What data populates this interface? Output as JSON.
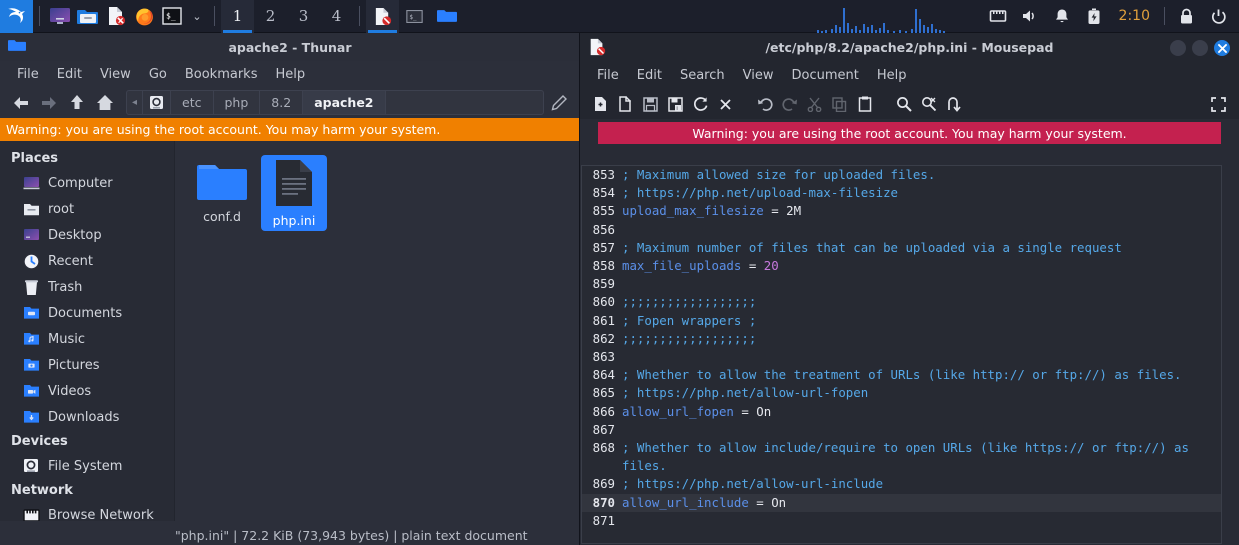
{
  "taskbar": {
    "kali_logo": "kali-dragon-logo",
    "launchers": [
      {
        "name": "show-desktop-icon",
        "label": "Show Desktop"
      },
      {
        "name": "file-manager-icon",
        "label": "File Manager"
      },
      {
        "name": "text-editor-icon",
        "label": "Text Editor"
      },
      {
        "name": "firefox-icon",
        "label": "Firefox"
      },
      {
        "name": "terminal-icon",
        "label": "Terminal"
      }
    ],
    "launcher_chevron": "⌄",
    "workspaces": [
      {
        "label": "1",
        "active": true
      },
      {
        "label": "2",
        "active": false
      },
      {
        "label": "3",
        "active": false
      },
      {
        "label": "4",
        "active": false
      }
    ],
    "windows": [
      {
        "name": "taskbar-window-mousepad",
        "icon": "text-editor-icon",
        "active": true
      },
      {
        "name": "taskbar-window-terminal",
        "icon": "terminal-icon",
        "active": false
      },
      {
        "name": "taskbar-window-thunar",
        "icon": "folder-icon",
        "active": false
      }
    ],
    "tray": {
      "network_icon": "network-icon",
      "volume_icon": "volume-icon",
      "notification_icon": "bell-icon",
      "battery_icon": "battery-icon",
      "clock": "2:10",
      "lock_icon": "lock-icon",
      "logout_icon": "logout-icon"
    }
  },
  "thunar": {
    "title": "apache2 - Thunar",
    "titlebar_icon": "folder-icon",
    "menus": [
      "File",
      "Edit",
      "View",
      "Go",
      "Bookmarks",
      "Help"
    ],
    "toolbar": {
      "back": "back-arrow-icon",
      "forward": "forward-arrow-icon",
      "up": "up-arrow-icon",
      "home": "home-icon",
      "edit_path": "pencil-icon"
    },
    "breadcrumbs": [
      {
        "label": "◂",
        "type": "scroll"
      },
      {
        "label": "",
        "type": "disk"
      },
      {
        "label": "etc",
        "type": "dir"
      },
      {
        "label": "php",
        "type": "dir"
      },
      {
        "label": "8.2",
        "type": "dir"
      },
      {
        "label": "apache2",
        "type": "current"
      }
    ],
    "warning": "Warning: you are using the root account. You may harm your system.",
    "sidebar": {
      "sections": [
        {
          "title": "Places",
          "items": [
            {
              "label": "Computer",
              "icon": "computer-icon"
            },
            {
              "label": "root",
              "icon": "home-folder-icon"
            },
            {
              "label": "Desktop",
              "icon": "desktop-icon"
            },
            {
              "label": "Recent",
              "icon": "clock-icon"
            },
            {
              "label": "Trash",
              "icon": "trash-icon"
            },
            {
              "label": "Documents",
              "icon": "documents-folder-icon"
            },
            {
              "label": "Music",
              "icon": "music-folder-icon"
            },
            {
              "label": "Pictures",
              "icon": "pictures-folder-icon"
            },
            {
              "label": "Videos",
              "icon": "videos-folder-icon"
            },
            {
              "label": "Downloads",
              "icon": "downloads-folder-icon"
            }
          ]
        },
        {
          "title": "Devices",
          "items": [
            {
              "label": "File System",
              "icon": "drive-icon"
            }
          ]
        },
        {
          "title": "Network",
          "items": [
            {
              "label": "Browse Network",
              "icon": "network-icon"
            }
          ]
        }
      ]
    },
    "files": [
      {
        "label": "conf.d",
        "type": "folder",
        "selected": false
      },
      {
        "label": "php.ini",
        "type": "file",
        "selected": true
      }
    ],
    "status": "\"php.ini\" | 72.2 KiB (73,943 bytes) | plain text document"
  },
  "mousepad": {
    "title": "/etc/php/8.2/apache2/php.ini - Mousepad",
    "titlebar_icon": "text-editor-icon",
    "menus": [
      "File",
      "Edit",
      "Search",
      "View",
      "Document",
      "Help"
    ],
    "toolbar": [
      {
        "name": "new-file-icon",
        "dim": false
      },
      {
        "name": "open-file-icon",
        "dim": false
      },
      {
        "name": "save-icon",
        "dim": false
      },
      {
        "name": "save-as-icon",
        "dim": false
      },
      {
        "name": "reload-icon",
        "dim": false
      },
      {
        "name": "close-file-icon",
        "dim": false
      },
      {
        "name": "undo-icon",
        "dim": false
      },
      {
        "name": "redo-icon",
        "dim": true
      },
      {
        "name": "cut-icon",
        "dim": true
      },
      {
        "name": "copy-icon",
        "dim": true
      },
      {
        "name": "paste-icon",
        "dim": false
      },
      {
        "name": "find-icon",
        "dim": false
      },
      {
        "name": "find-replace-icon",
        "dim": false
      },
      {
        "name": "jump-to-icon",
        "dim": false
      }
    ],
    "fullscreen_icon": "fullscreen-icon",
    "window_buttons": {
      "minimize": "minimize-icon",
      "maximize": "maximize-icon",
      "close": "close-icon"
    },
    "warning": "Warning: you are using the root account. You may harm your system.",
    "editor": {
      "current_line": 870,
      "lines": [
        {
          "num": "853",
          "parts": [
            {
              "t": "; Maximum allowed size for uploaded files.",
              "c": "c-comment"
            }
          ]
        },
        {
          "num": "854",
          "parts": [
            {
              "t": "; https://php.net/upload-max-filesize",
              "c": "c-comment"
            }
          ]
        },
        {
          "num": "855",
          "parts": [
            {
              "t": "upload_max_filesize",
              "c": "c-key"
            },
            {
              "t": " = ",
              "c": "c-op"
            },
            {
              "t": "2M",
              "c": "c-val"
            }
          ]
        },
        {
          "num": "856",
          "parts": [
            {
              "t": "",
              "c": "c-val"
            }
          ]
        },
        {
          "num": "857",
          "parts": [
            {
              "t": "; Maximum number of files that can be uploaded via a single request",
              "c": "c-comment"
            }
          ]
        },
        {
          "num": "858",
          "parts": [
            {
              "t": "max_file_uploads",
              "c": "c-key"
            },
            {
              "t": " = ",
              "c": "c-op"
            },
            {
              "t": "20",
              "c": "c-num"
            }
          ]
        },
        {
          "num": "859",
          "parts": [
            {
              "t": "",
              "c": "c-val"
            }
          ]
        },
        {
          "num": "860",
          "parts": [
            {
              "t": ";;;;;;;;;;;;;;;;;;",
              "c": "c-comment"
            }
          ]
        },
        {
          "num": "861",
          "parts": [
            {
              "t": "; Fopen wrappers ;",
              "c": "c-comment"
            }
          ]
        },
        {
          "num": "862",
          "parts": [
            {
              "t": ";;;;;;;;;;;;;;;;;;",
              "c": "c-comment"
            }
          ]
        },
        {
          "num": "863",
          "parts": [
            {
              "t": "",
              "c": "c-val"
            }
          ]
        },
        {
          "num": "864",
          "parts": [
            {
              "t": "; Whether to allow the treatment of URLs (like http:// or ftp://) as files.",
              "c": "c-comment"
            }
          ]
        },
        {
          "num": "865",
          "parts": [
            {
              "t": "; https://php.net/allow-url-fopen",
              "c": "c-comment"
            }
          ]
        },
        {
          "num": "866",
          "parts": [
            {
              "t": "allow_url_fopen",
              "c": "c-key"
            },
            {
              "t": " = ",
              "c": "c-op"
            },
            {
              "t": "On",
              "c": "c-val"
            }
          ]
        },
        {
          "num": "867",
          "parts": [
            {
              "t": "",
              "c": "c-val"
            }
          ]
        },
        {
          "num": "868",
          "parts": [
            {
              "t": "; Whether to allow include/require to open URLs (like https:// or ftp://) as files.",
              "c": "c-comment"
            }
          ]
        },
        {
          "num": "869",
          "parts": [
            {
              "t": "; https://php.net/allow-url-include",
              "c": "c-comment"
            }
          ]
        },
        {
          "num": "870",
          "parts": [
            {
              "t": "allow_url_include",
              "c": "c-key"
            },
            {
              "t": " = ",
              "c": "c-op"
            },
            {
              "t": "On",
              "c": "c-val"
            }
          ]
        },
        {
          "num": "871",
          "parts": [
            {
              "t": "",
              "c": "c-val"
            }
          ]
        }
      ]
    }
  },
  "colors": {
    "accent_blue": "#1f7ce0",
    "selection_blue": "#2a7fff",
    "thunar_warning_orange": "#f08000",
    "mousepad_warning_crimson": "#c4214f",
    "desktop_navy": "#161634",
    "clock_amber": "#e0a03c"
  }
}
